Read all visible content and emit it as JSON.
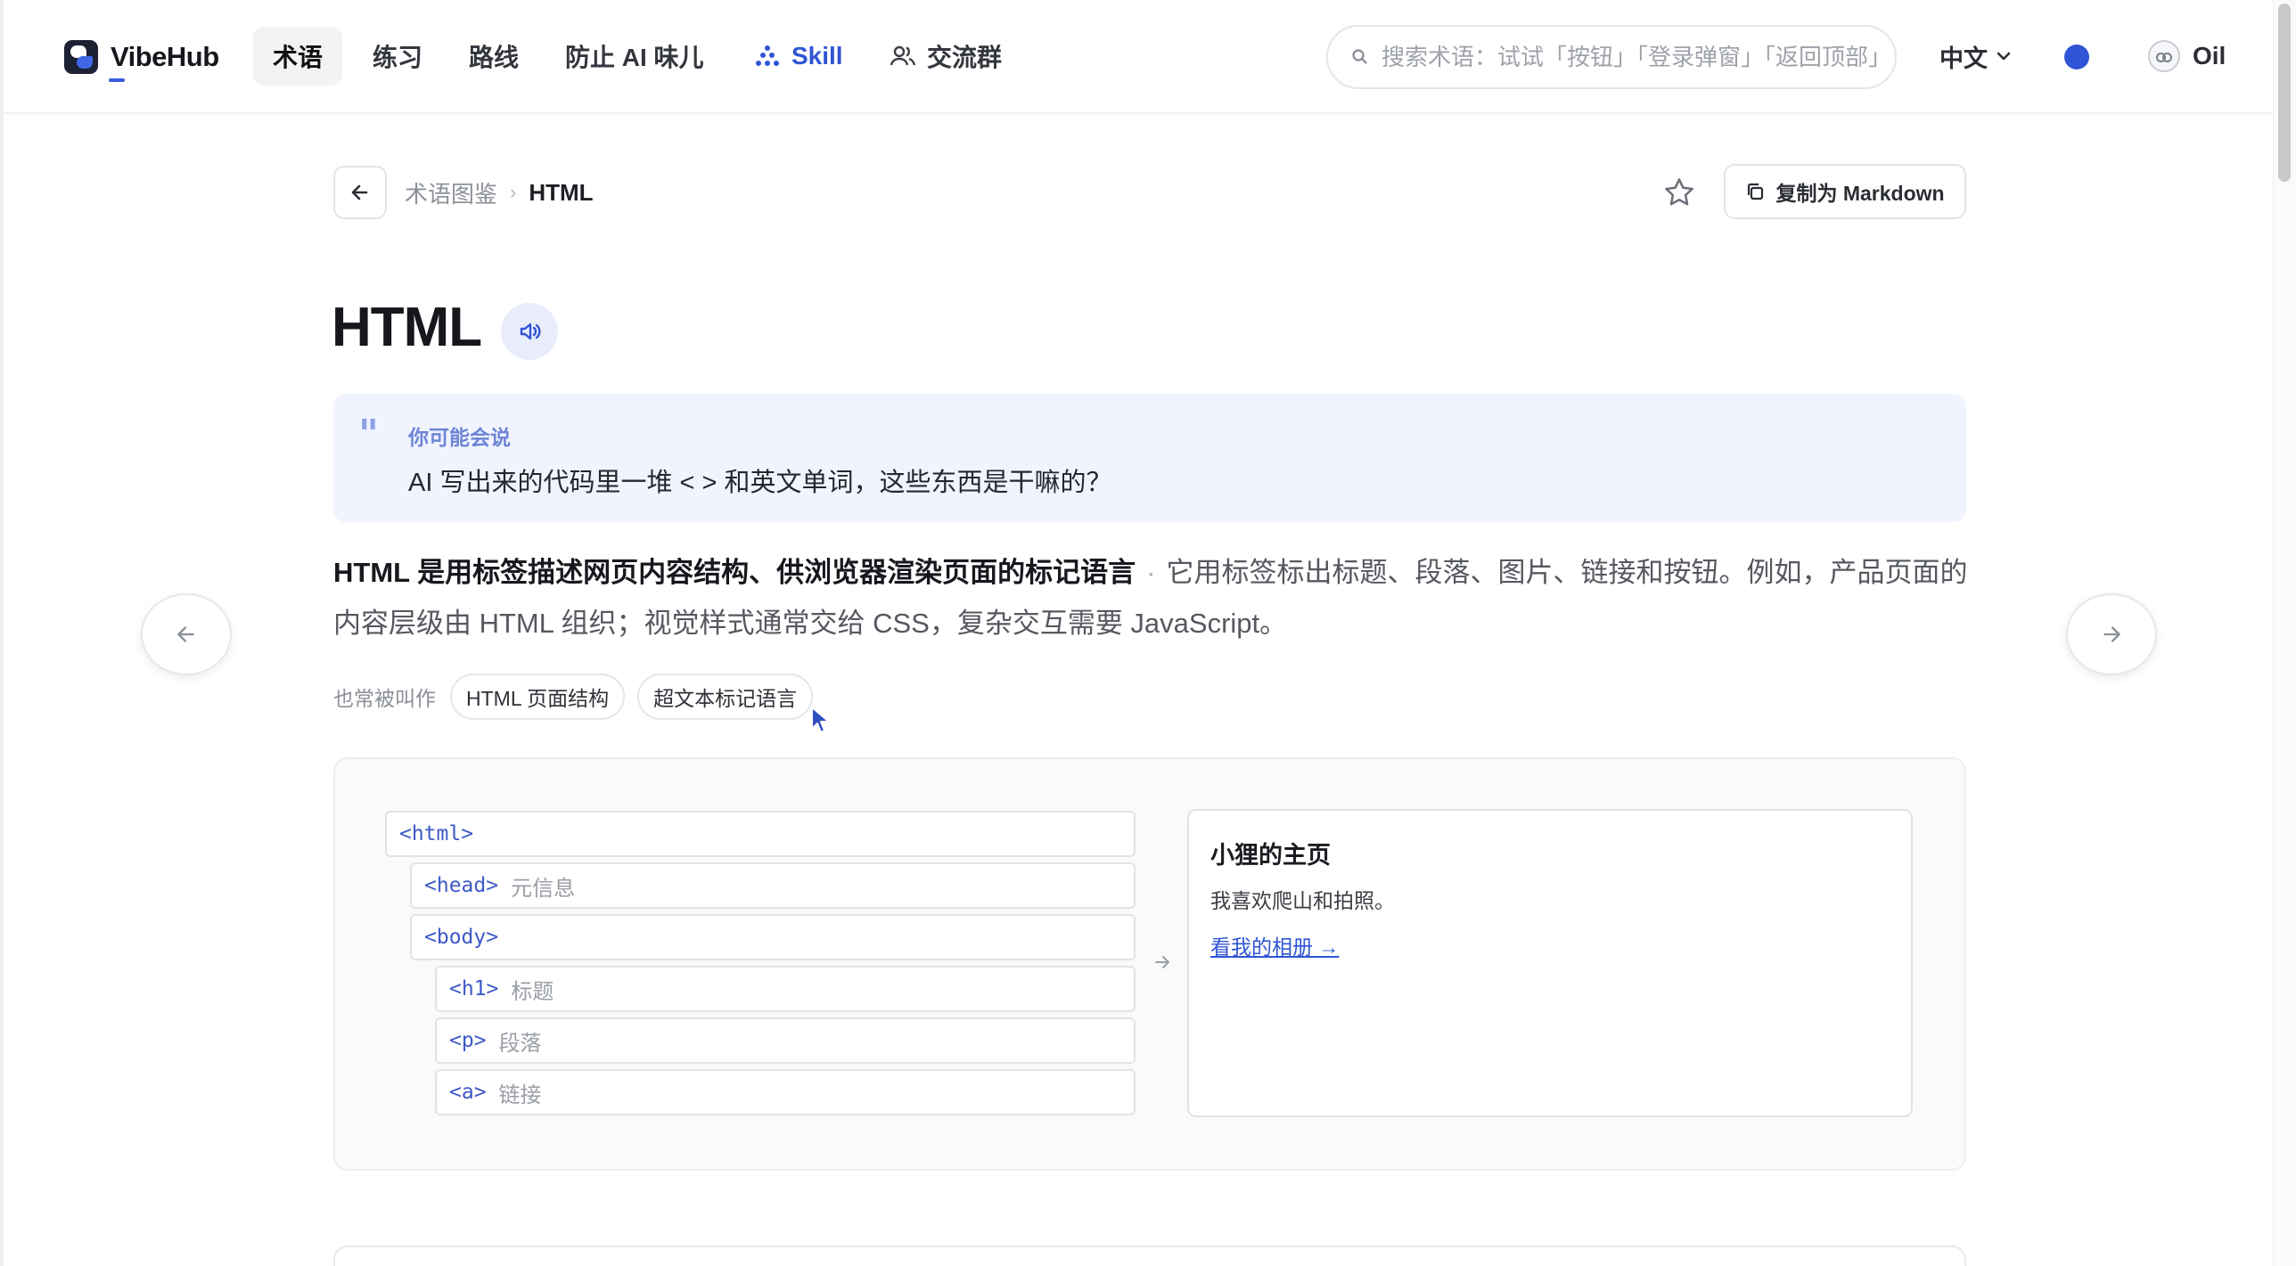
{
  "colors": {
    "accent": "#3054d6",
    "quote_bg": "#f1f4fe",
    "link": "#2f55d4"
  },
  "nav": {
    "brand": "VibeHub",
    "items": [
      {
        "label": "术语",
        "active": true
      },
      {
        "label": "练习"
      },
      {
        "label": "路线"
      },
      {
        "label": "防止 AI 味儿"
      },
      {
        "label": "Skill",
        "icon": "skill-tree-icon"
      },
      {
        "label": "交流群",
        "icon": "group-icon"
      }
    ],
    "search_placeholder": "搜索术语：试试「按钮」「登录弹窗」「返回顶部」",
    "language": "中文",
    "user_name": "Oil"
  },
  "breadcrumb": {
    "root": "术语图鉴",
    "current": "HTML"
  },
  "actions": {
    "copy_markdown": "复制为 Markdown"
  },
  "term": {
    "title": "HTML",
    "quote_label": "你可能会说",
    "quote_text": "AI 写出来的代码里一堆 < > 和英文单词，这些东西是干嘛的？",
    "definition_strong": "HTML 是用标签描述网页内容结构、供浏览器渲染页面的标记语言",
    "definition_dot": "·",
    "definition_rest": "它用标签标出标题、段落、图片、链接和按钮。例如，产品页面的内容层级由 HTML 组织；视觉样式通常交给 CSS，复杂交互需要 JavaScript。",
    "aliases_label": "也常被叫作",
    "aliases": [
      "HTML 页面结构",
      "超文本标记语言"
    ]
  },
  "demo": {
    "tree": [
      {
        "tag": "<html>",
        "desc": ""
      },
      {
        "tag": "<head>",
        "desc": "元信息"
      },
      {
        "tag": "<body>",
        "desc": ""
      },
      {
        "tag": "<h1>",
        "desc": "标题"
      },
      {
        "tag": "<p>",
        "desc": "段落"
      },
      {
        "tag": "<a>",
        "desc": "链接"
      }
    ],
    "preview": {
      "title": "小狸的主页",
      "text": "我喜欢爬山和拍照。",
      "link": "看我的相册 →"
    }
  }
}
